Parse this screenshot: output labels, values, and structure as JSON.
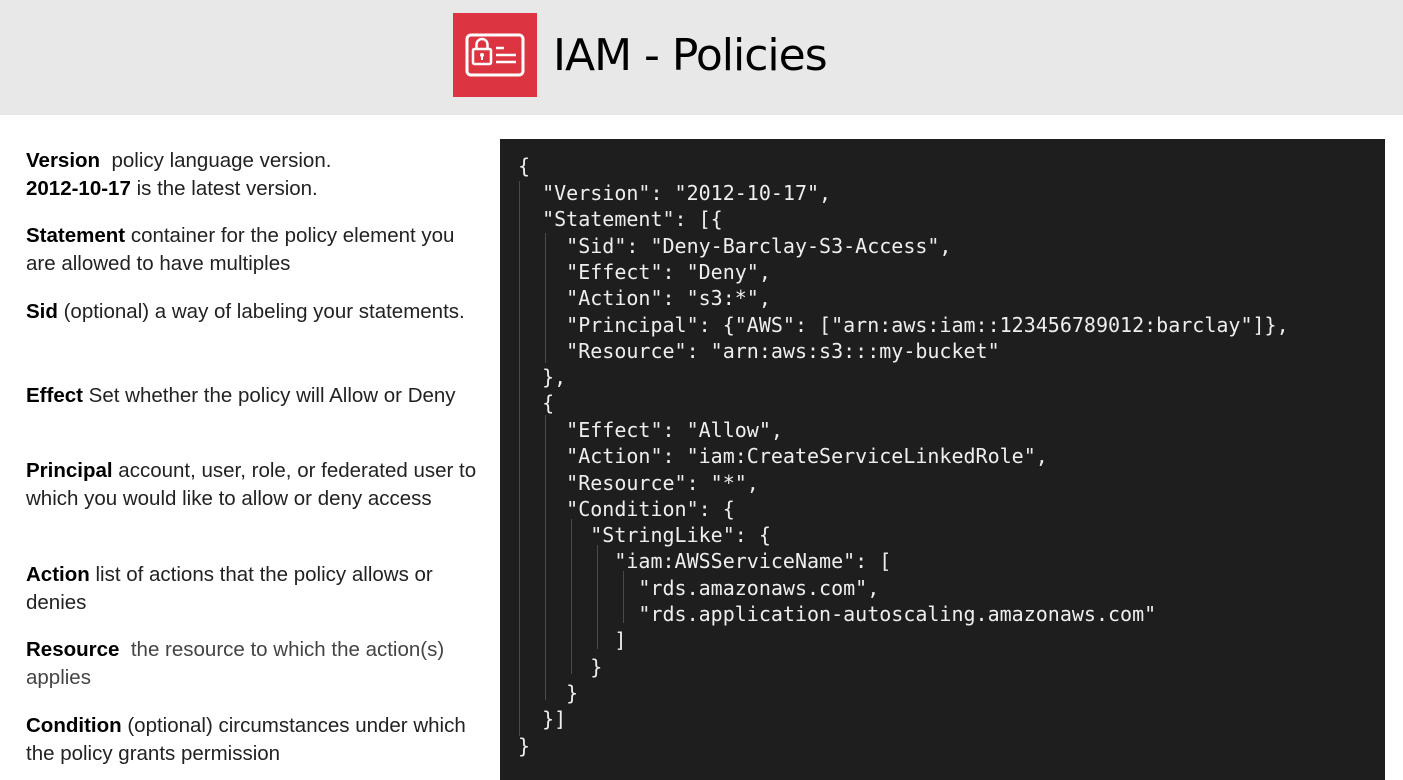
{
  "header": {
    "title": "IAM - Policies",
    "icon": "iam-card-lock-icon",
    "icon_color": "#dd3441",
    "background": "#e8e8e8"
  },
  "definitions": [
    {
      "term": "Version",
      "text": "policy language version."
    },
    {
      "term": "2012-10-17",
      "text": "is the latest version."
    },
    {
      "term": "Statement",
      "text": "container for the policy element you are allowed to have multiples"
    },
    {
      "term": "Sid",
      "text": "(optional) a way of labeling your statements."
    },
    {
      "term": "Effect",
      "text": "Set whether the policy will  Allow or Deny"
    },
    {
      "term": "Principal",
      "text": "account, user, role, or federated user to which you would like to allow or deny access"
    },
    {
      "term": "Action",
      "text": "list of actions that the policy allows or denies"
    },
    {
      "term": "Resource",
      "text": "the resource to which the action(s) applies"
    },
    {
      "term": "Condition",
      "text": "(optional) circumstances under which the policy grants permission"
    }
  ],
  "code": {
    "background": "#1e1e1e",
    "lines": [
      "{",
      "  \"Version\": \"2012-10-17\",",
      "  \"Statement\": [{",
      "    \"Sid\": \"Deny-Barclay-S3-Access\",",
      "    \"Effect\": \"Deny\",",
      "    \"Action\": \"s3:*\",",
      "    \"Principal\": {\"AWS\": [\"arn:aws:iam::123456789012:barclay\"]},",
      "    \"Resource\": \"arn:aws:s3:::my-bucket\"",
      "  },",
      "  {",
      "    \"Effect\": \"Allow\",",
      "    \"Action\": \"iam:CreateServiceLinkedRole\",",
      "    \"Resource\": \"*\",",
      "    \"Condition\": {",
      "      \"StringLike\": {",
      "        \"iam:AWSServiceName\": [",
      "          \"rds.amazonaws.com\",",
      "          \"rds.application-autoscaling.amazonaws.com\"",
      "        ]",
      "      }",
      "    }",
      "  }]",
      "}"
    ]
  }
}
